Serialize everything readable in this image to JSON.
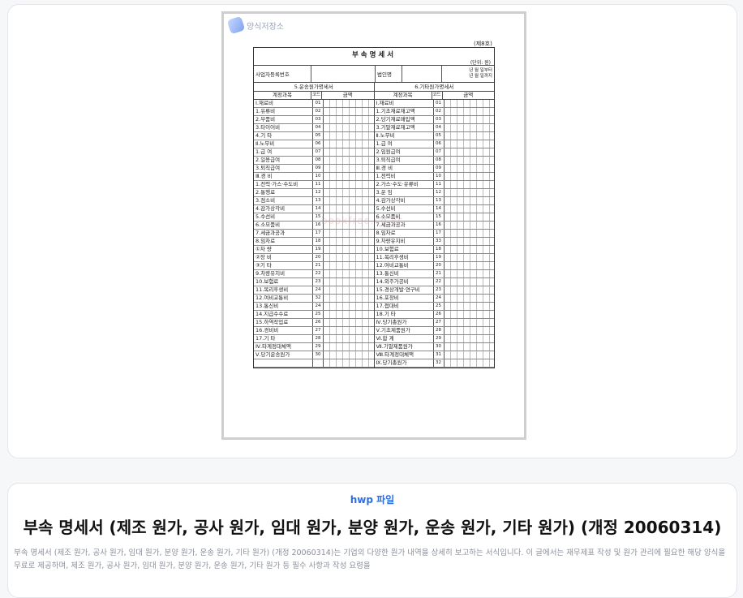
{
  "preview": {
    "logo_text": "양식저장소",
    "watermark": "bookfree.co.kr",
    "form_no": "(제8호)",
    "sheet_title": "부속명세서",
    "unit_label": "(단위: 원)",
    "info_row": {
      "biz_no_label": "사업자등록번호",
      "corp_name_label": "법인명",
      "year_label": "년 월 일",
      "period_from": "년 월 일부터",
      "period_to": "년 월 일까지"
    },
    "left_section_title": "5.운송원가명세서",
    "right_section_title": "6.기타원가명세서",
    "col_headers": {
      "item": "계정과목",
      "code": "코드",
      "amount": "금액"
    },
    "left_rows": [
      {
        "name": "Ⅰ.재료비",
        "code": "01"
      },
      {
        "name": " 1.유류비",
        "code": "02"
      },
      {
        "name": " 2.부품비",
        "code": "03"
      },
      {
        "name": " 3.타이어비",
        "code": "04"
      },
      {
        "name": " 4.기  타",
        "code": "05"
      },
      {
        "name": "Ⅱ.노무비",
        "code": "06"
      },
      {
        "name": " 1.급    여",
        "code": "07"
      },
      {
        "name": " 2.일용급여",
        "code": "08"
      },
      {
        "name": " 3.퇴직급여",
        "code": "09"
      },
      {
        "name": "Ⅲ.경  비",
        "code": "10"
      },
      {
        "name": " 1.전력·가스·수도비",
        "code": "11"
      },
      {
        "name": " 2.통행료",
        "code": "12"
      },
      {
        "name": " 3.점소비",
        "code": "13"
      },
      {
        "name": " 4.감가상각비",
        "code": "14"
      },
      {
        "name": " 5.수선비",
        "code": "15"
      },
      {
        "name": " 6.소모품비",
        "code": "16"
      },
      {
        "name": " 7.세금과공과",
        "code": "17"
      },
      {
        "name": " 8.임차료",
        "code": "18"
      },
      {
        "name": "   ①차  량",
        "code": "19"
      },
      {
        "name": "   ②장  비",
        "code": "20"
      },
      {
        "name": "   ③기  타",
        "code": "21"
      },
      {
        "name": " 9.차량유지비",
        "code": "22"
      },
      {
        "name": " 10.보험료",
        "code": "23"
      },
      {
        "name": " 11.복리후생비",
        "code": "24"
      },
      {
        "name": " 12.여비교통비",
        "code": "32"
      },
      {
        "name": " 13.통신비",
        "code": "24"
      },
      {
        "name": " 14.지급수수료",
        "code": "25"
      },
      {
        "name": " 15.하역작업료",
        "code": "26"
      },
      {
        "name": " 16.경비비",
        "code": "27"
      },
      {
        "name": " 17.기  타",
        "code": "28"
      },
      {
        "name": "Ⅳ.타계정대체액",
        "code": "29"
      },
      {
        "name": "Ⅴ.당기운송원가",
        "code": "30"
      },
      {
        "name": "",
        "code": ""
      }
    ],
    "right_rows": [
      {
        "name": "Ⅰ.재료비",
        "code": "01"
      },
      {
        "name": " 1.기초재료재고액",
        "code": "02"
      },
      {
        "name": " 2.당기재료매입액",
        "code": "03"
      },
      {
        "name": " 3.기말재료재고액",
        "code": "04"
      },
      {
        "name": "Ⅱ.노무비",
        "code": "05"
      },
      {
        "name": " 1.급    여",
        "code": "06"
      },
      {
        "name": " 2.임원급여",
        "code": "07"
      },
      {
        "name": " 3.퇴직급여",
        "code": "08"
      },
      {
        "name": "Ⅲ.경  비",
        "code": "09"
      },
      {
        "name": " 1.전력비",
        "code": "10"
      },
      {
        "name": " 2.가스·수도·유류비",
        "code": "11"
      },
      {
        "name": " 3.운  임",
        "code": "12"
      },
      {
        "name": " 4.감가상각비",
        "code": "13"
      },
      {
        "name": " 5.수선비",
        "code": "14"
      },
      {
        "name": " 6.소모품비",
        "code": "15"
      },
      {
        "name": " 7.세금과공과",
        "code": "16"
      },
      {
        "name": " 8.임차료",
        "code": "17"
      },
      {
        "name": " 9.차량유지비",
        "code": "33"
      },
      {
        "name": " 10.보험료",
        "code": "18"
      },
      {
        "name": " 11.복리후생비",
        "code": "19"
      },
      {
        "name": " 12.여비교통비",
        "code": "20"
      },
      {
        "name": " 13.통신비",
        "code": "21"
      },
      {
        "name": " 14.외주가공비",
        "code": "22"
      },
      {
        "name": " 15.경상개발·연구비",
        "code": "23"
      },
      {
        "name": " 16.포장비",
        "code": "24"
      },
      {
        "name": " 17.접대비",
        "code": "25"
      },
      {
        "name": " 18.기  타",
        "code": "26"
      },
      {
        "name": "Ⅳ.당기총원가",
        "code": "27"
      },
      {
        "name": "Ⅴ.기초제품원가",
        "code": "28"
      },
      {
        "name": "Ⅵ.합    계",
        "code": "29"
      },
      {
        "name": "Ⅶ.기말제품원가",
        "code": "30"
      },
      {
        "name": "Ⅷ.타계정대체액",
        "code": "31"
      },
      {
        "name": "Ⅸ.당기총원가",
        "code": "32"
      }
    ]
  },
  "info": {
    "category": "hwp 파일",
    "title": "부속 명세서 (제조 원가, 공사 원가, 임대 원가, 분양 원가, 운송 원가, 기타 원가) (개정 20060314)",
    "description": "부속 명세서 (제조 원가, 공사 원가, 임대 원가, 분양 원가, 운송 원가, 기타 원가) (개정 20060314)는 기업의 다양한 원가 내역을 상세히 보고하는 서식입니다. 이 글에서는 재무제표 작성 및 원가 관리에 필요한 해당 양식을 무료로 제공하며, 제조 원가, 공사 원가, 임대 원가, 분양 원가, 운송 원가, 기타 원가 등 필수 사항과 작성 요령을"
  }
}
